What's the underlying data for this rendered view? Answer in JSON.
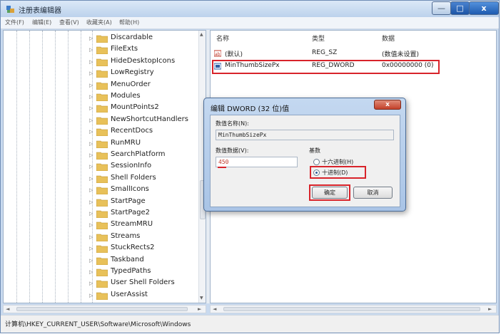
{
  "window": {
    "title": "注册表编辑器",
    "controls": {
      "minimize": "—",
      "maximize": "□",
      "close": "x"
    }
  },
  "menu": [
    "文件(F)",
    "编辑(E)",
    "查看(V)",
    "收藏夹(A)",
    "帮助(H)"
  ],
  "tree": {
    "items": [
      "Discardable",
      "FileExts",
      "HideDesktopIcons",
      "LowRegistry",
      "MenuOrder",
      "Modules",
      "MountPoints2",
      "NewShortcutHandlers",
      "RecentDocs",
      "RunMRU",
      "SearchPlatform",
      "SessionInfo",
      "Shell Folders",
      "SmallIcons",
      "StartPage",
      "StartPage2",
      "StreamMRU",
      "Streams",
      "StuckRects2",
      "Taskband",
      "TypedPaths",
      "User Shell Folders",
      "UserAssist"
    ]
  },
  "list": {
    "columns": {
      "name": "名称",
      "type": "类型",
      "data": "数据"
    },
    "rows": [
      {
        "name": "(默认)",
        "type": "REG_SZ",
        "data": "(数值未设置)"
      },
      {
        "name": "MinThumbSizePx",
        "type": "REG_DWORD",
        "data": "0x00000000 (0)"
      }
    ]
  },
  "status": "计算机\\HKEY_CURRENT_USER\\Software\\Microsoft\\Windows",
  "dialog": {
    "title": "编辑 DWORD (32 位)值",
    "close": "x",
    "value_name_label": "数值名称(N):",
    "value_name": "MinThumbSizePx",
    "value_data_label": "数值数据(V):",
    "value_data": "450",
    "base_label": "基数",
    "radio_hex": "十六进制(H)",
    "radio_dec": "十进制(D)",
    "selected_base": "decimal",
    "ok": "确定",
    "cancel": "取消"
  },
  "colors": {
    "highlight": "#d8232a",
    "titlebar": "#bcd2ec",
    "folder": "#e8c15a"
  }
}
